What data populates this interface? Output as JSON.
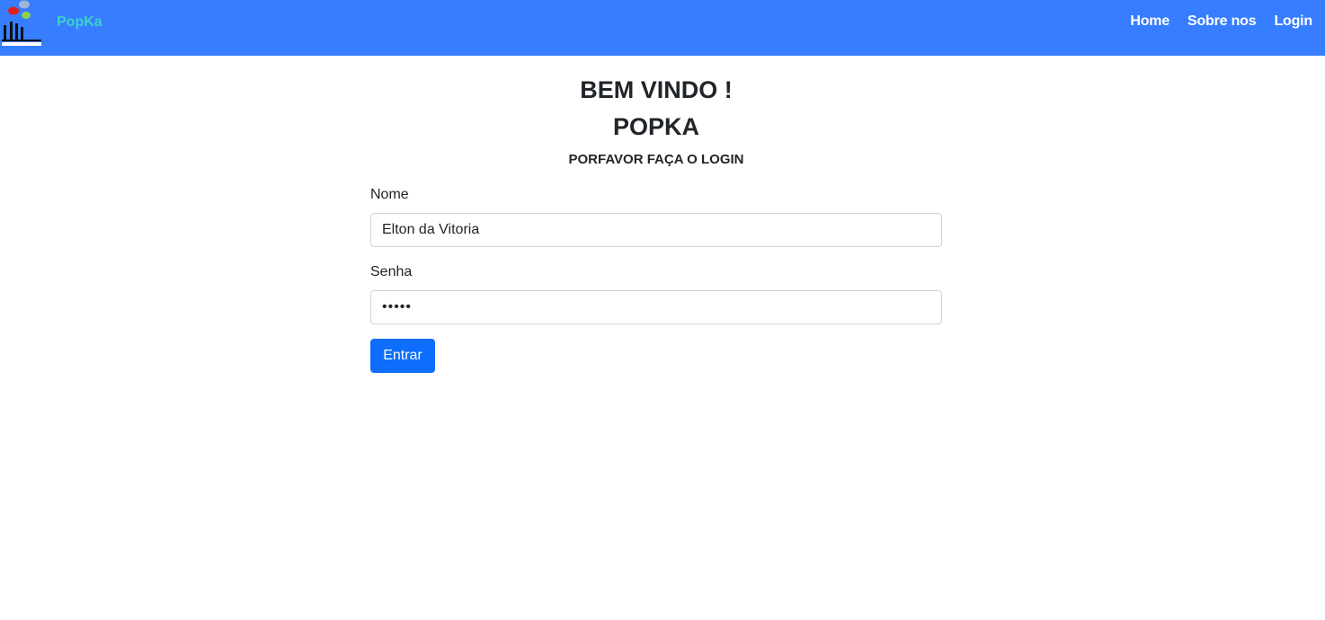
{
  "navbar": {
    "brand": "PopKa",
    "links": [
      {
        "label": "Home"
      },
      {
        "label": "Sobre nos"
      },
      {
        "label": "Login"
      }
    ],
    "logo_icon": "hands-speech-bubbles-logo",
    "background_color": "#377dff",
    "brand_color": "#3bd3c9"
  },
  "main": {
    "welcome": "BEM VINDO !",
    "title": "POPKA",
    "subtitle": "PORFAVOR FAÇA O LOGIN"
  },
  "form": {
    "name_label": "Nome",
    "name_value": "Elton da Vitoria",
    "password_label": "Senha",
    "password_value": "•••••",
    "submit_label": "Entrar",
    "submit_color": "#0d6efd"
  }
}
